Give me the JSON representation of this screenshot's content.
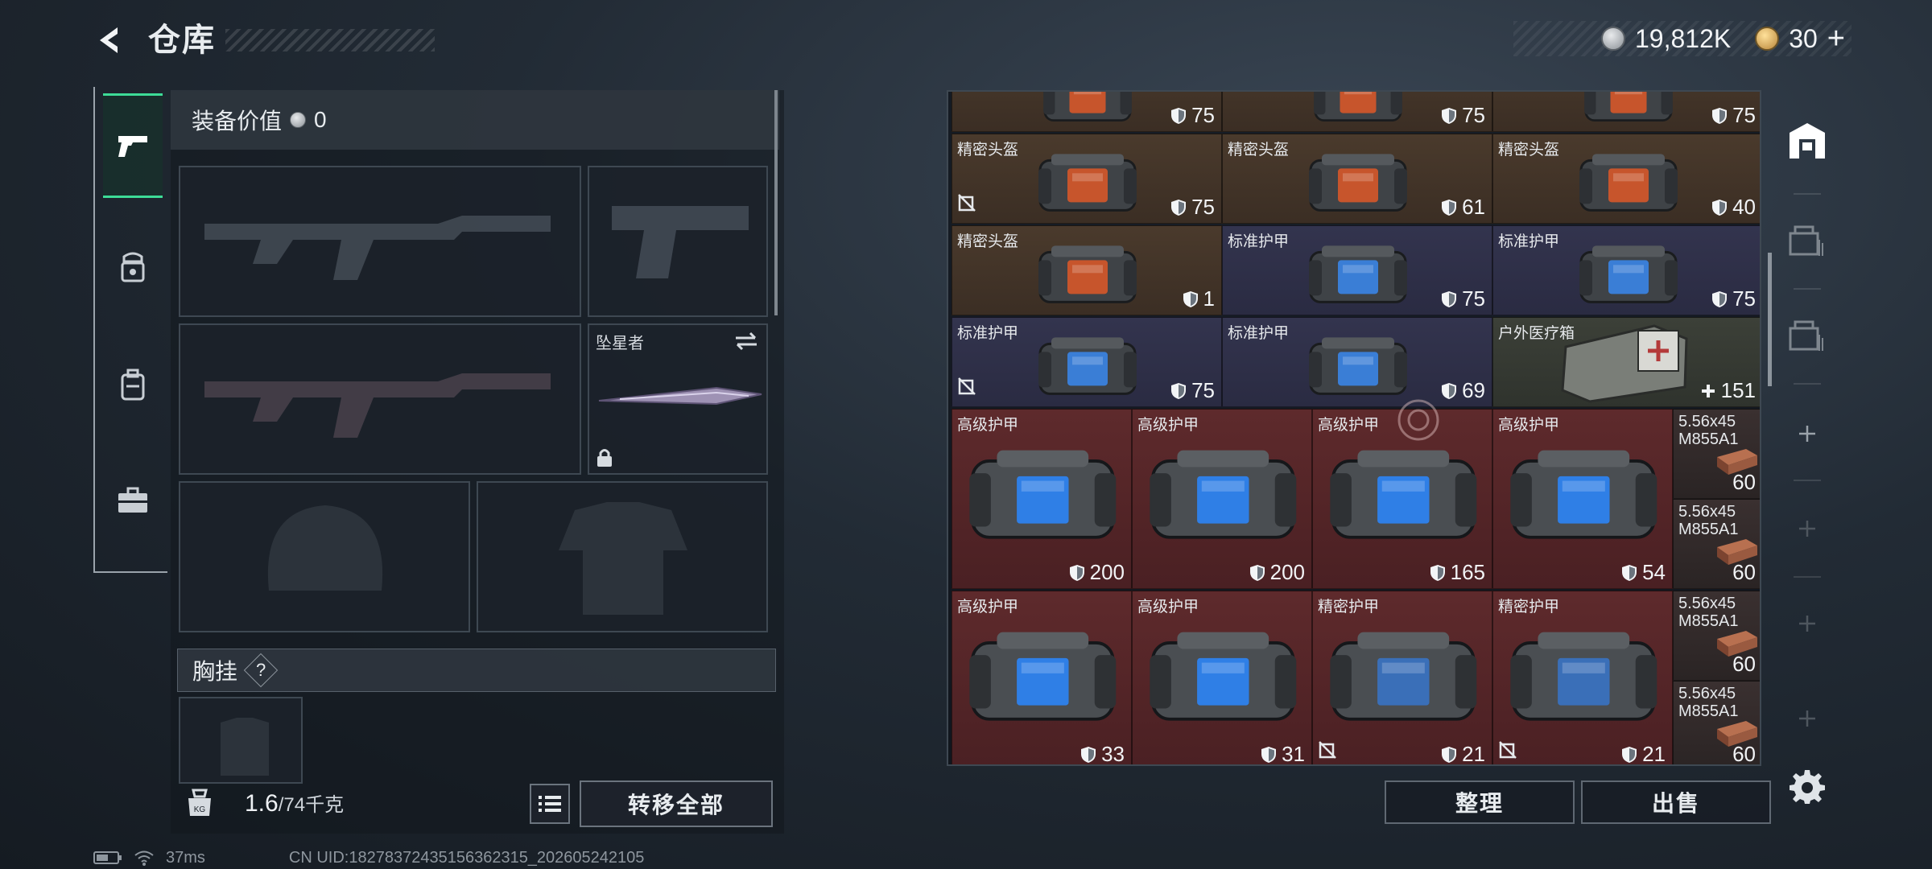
{
  "header": {
    "title": "仓库",
    "currency_amount": "19,812K",
    "premium_amount": "30",
    "plus_label": "+"
  },
  "sidebar": {
    "tabs": [
      {
        "name": "weapon-tab",
        "icon": "pistol-icon",
        "active": true
      },
      {
        "name": "gear-tab",
        "icon": "helmet-armor-icon",
        "active": false
      },
      {
        "name": "backpack-tab",
        "icon": "backpack-icon",
        "active": false
      },
      {
        "name": "case-tab",
        "icon": "briefcase-icon",
        "active": false
      }
    ]
  },
  "loadout": {
    "equip_value_label": "装备价值",
    "equip_value": "0",
    "melee_name": "坠星者",
    "vest_label": "胸挂",
    "vest_help": "?",
    "weight_current": "1.6",
    "weight_max": "/74千克",
    "weight_icon_label": "KG",
    "transfer_all_label": "转移全部"
  },
  "storage": {
    "cells": [
      {
        "name": "",
        "dur": "75",
        "color": "brown",
        "type": "helmet",
        "icon": "shield"
      },
      {
        "name": "",
        "dur": "75",
        "color": "brown",
        "type": "helmet",
        "icon": "shield"
      },
      {
        "name": "",
        "dur": "75",
        "color": "brown",
        "type": "helmet",
        "icon": "shield"
      },
      {
        "name": "精密头盔",
        "dur": "75",
        "color": "brown",
        "type": "helmet",
        "icon": "shield",
        "locked": true
      },
      {
        "name": "精密头盔",
        "dur": "61",
        "color": "brown",
        "type": "helmet",
        "icon": "shield"
      },
      {
        "name": "精密头盔",
        "dur": "40",
        "color": "brown",
        "type": "helmet",
        "icon": "shield"
      },
      {
        "name": "精密头盔",
        "dur": "1",
        "color": "brown",
        "type": "helmet",
        "icon": "shield"
      },
      {
        "name": "标准护甲",
        "dur": "75",
        "color": "blue",
        "type": "armor",
        "icon": "shield"
      },
      {
        "name": "标准护甲",
        "dur": "75",
        "color": "blue",
        "type": "armor",
        "icon": "shield"
      },
      {
        "name": "标准护甲",
        "dur": "75",
        "color": "blue",
        "type": "armor",
        "icon": "shield",
        "locked": true
      },
      {
        "name": "标准护甲",
        "dur": "69",
        "color": "blue",
        "type": "armor",
        "icon": "shield"
      },
      {
        "name": "户外医疗箱",
        "dur": "151",
        "color": "green",
        "type": "medkit",
        "icon": "plus"
      },
      {
        "name": "高级护甲",
        "dur": "200",
        "color": "red",
        "type": "bigarmor",
        "icon": "shield"
      },
      {
        "name": "高级护甲",
        "dur": "200",
        "color": "red",
        "type": "bigarmor",
        "icon": "shield"
      },
      {
        "name": "高级护甲",
        "dur": "165",
        "color": "red",
        "type": "bigarmor",
        "icon": "shield"
      },
      {
        "name": "高级护甲",
        "dur": "54",
        "color": "red",
        "type": "bigarmor",
        "icon": "shield"
      },
      {
        "name": "5.56x45\nM855A1",
        "dur": "60",
        "color": "dark",
        "type": "ammo",
        "icon": "none"
      },
      {
        "name": "5.56x45\nM855A1",
        "dur": "60",
        "color": "dark",
        "type": "ammo",
        "icon": "none"
      },
      {
        "name": "高级护甲",
        "dur": "33",
        "color": "red",
        "type": "bigarmor",
        "icon": "shield"
      },
      {
        "name": "高级护甲",
        "dur": "31",
        "color": "red",
        "type": "bigarmor",
        "icon": "shield"
      },
      {
        "name": "精密护甲",
        "dur": "21",
        "color": "red",
        "type": "bigarmor2",
        "icon": "shield",
        "locked": true
      },
      {
        "name": "精密护甲",
        "dur": "21",
        "color": "red",
        "type": "bigarmor2",
        "icon": "shield",
        "locked": true
      },
      {
        "name": "5.56x45\nM855A1",
        "dur": "60",
        "color": "dark",
        "type": "ammo",
        "icon": "none"
      },
      {
        "name": "5.56x45\nM855A1",
        "dur": "60",
        "color": "dark",
        "type": "ammo",
        "icon": "none"
      }
    ],
    "sort_label": "整理",
    "sell_label": "出售"
  },
  "status": {
    "ping": "37ms",
    "uid": "CN UID:18278372435156362315_202605242105"
  }
}
